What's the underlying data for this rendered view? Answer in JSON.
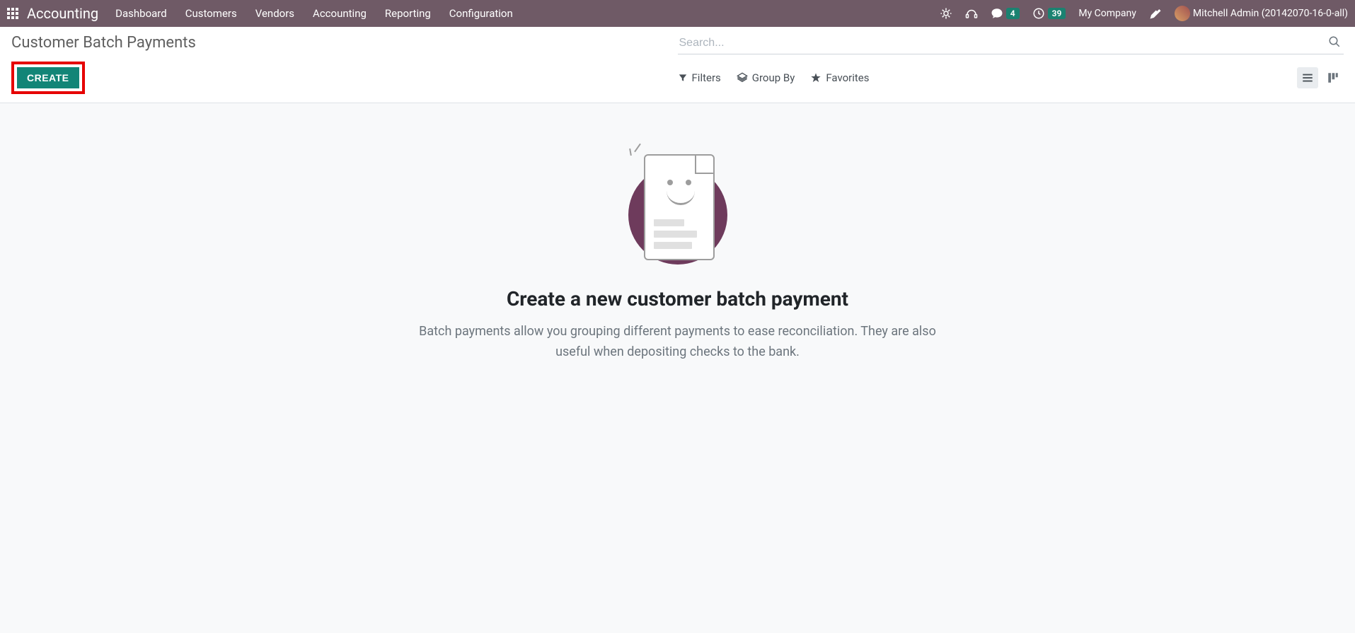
{
  "app": {
    "name": "Accounting"
  },
  "nav": {
    "items": [
      "Dashboard",
      "Customers",
      "Vendors",
      "Accounting",
      "Reporting",
      "Configuration"
    ]
  },
  "systray": {
    "messages_count": "4",
    "activities_count": "39",
    "company": "My Company",
    "user": "Mitchell Admin (20142070-16-0-all)"
  },
  "breadcrumb": "Customer Batch Payments",
  "buttons": {
    "create": "CREATE"
  },
  "search": {
    "placeholder": "Search...",
    "filters": "Filters",
    "group_by": "Group By",
    "favorites": "Favorites"
  },
  "empty": {
    "title": "Create a new customer batch payment",
    "desc": "Batch payments allow you grouping different payments to ease reconciliation. They are also useful when depositing checks to the bank."
  }
}
